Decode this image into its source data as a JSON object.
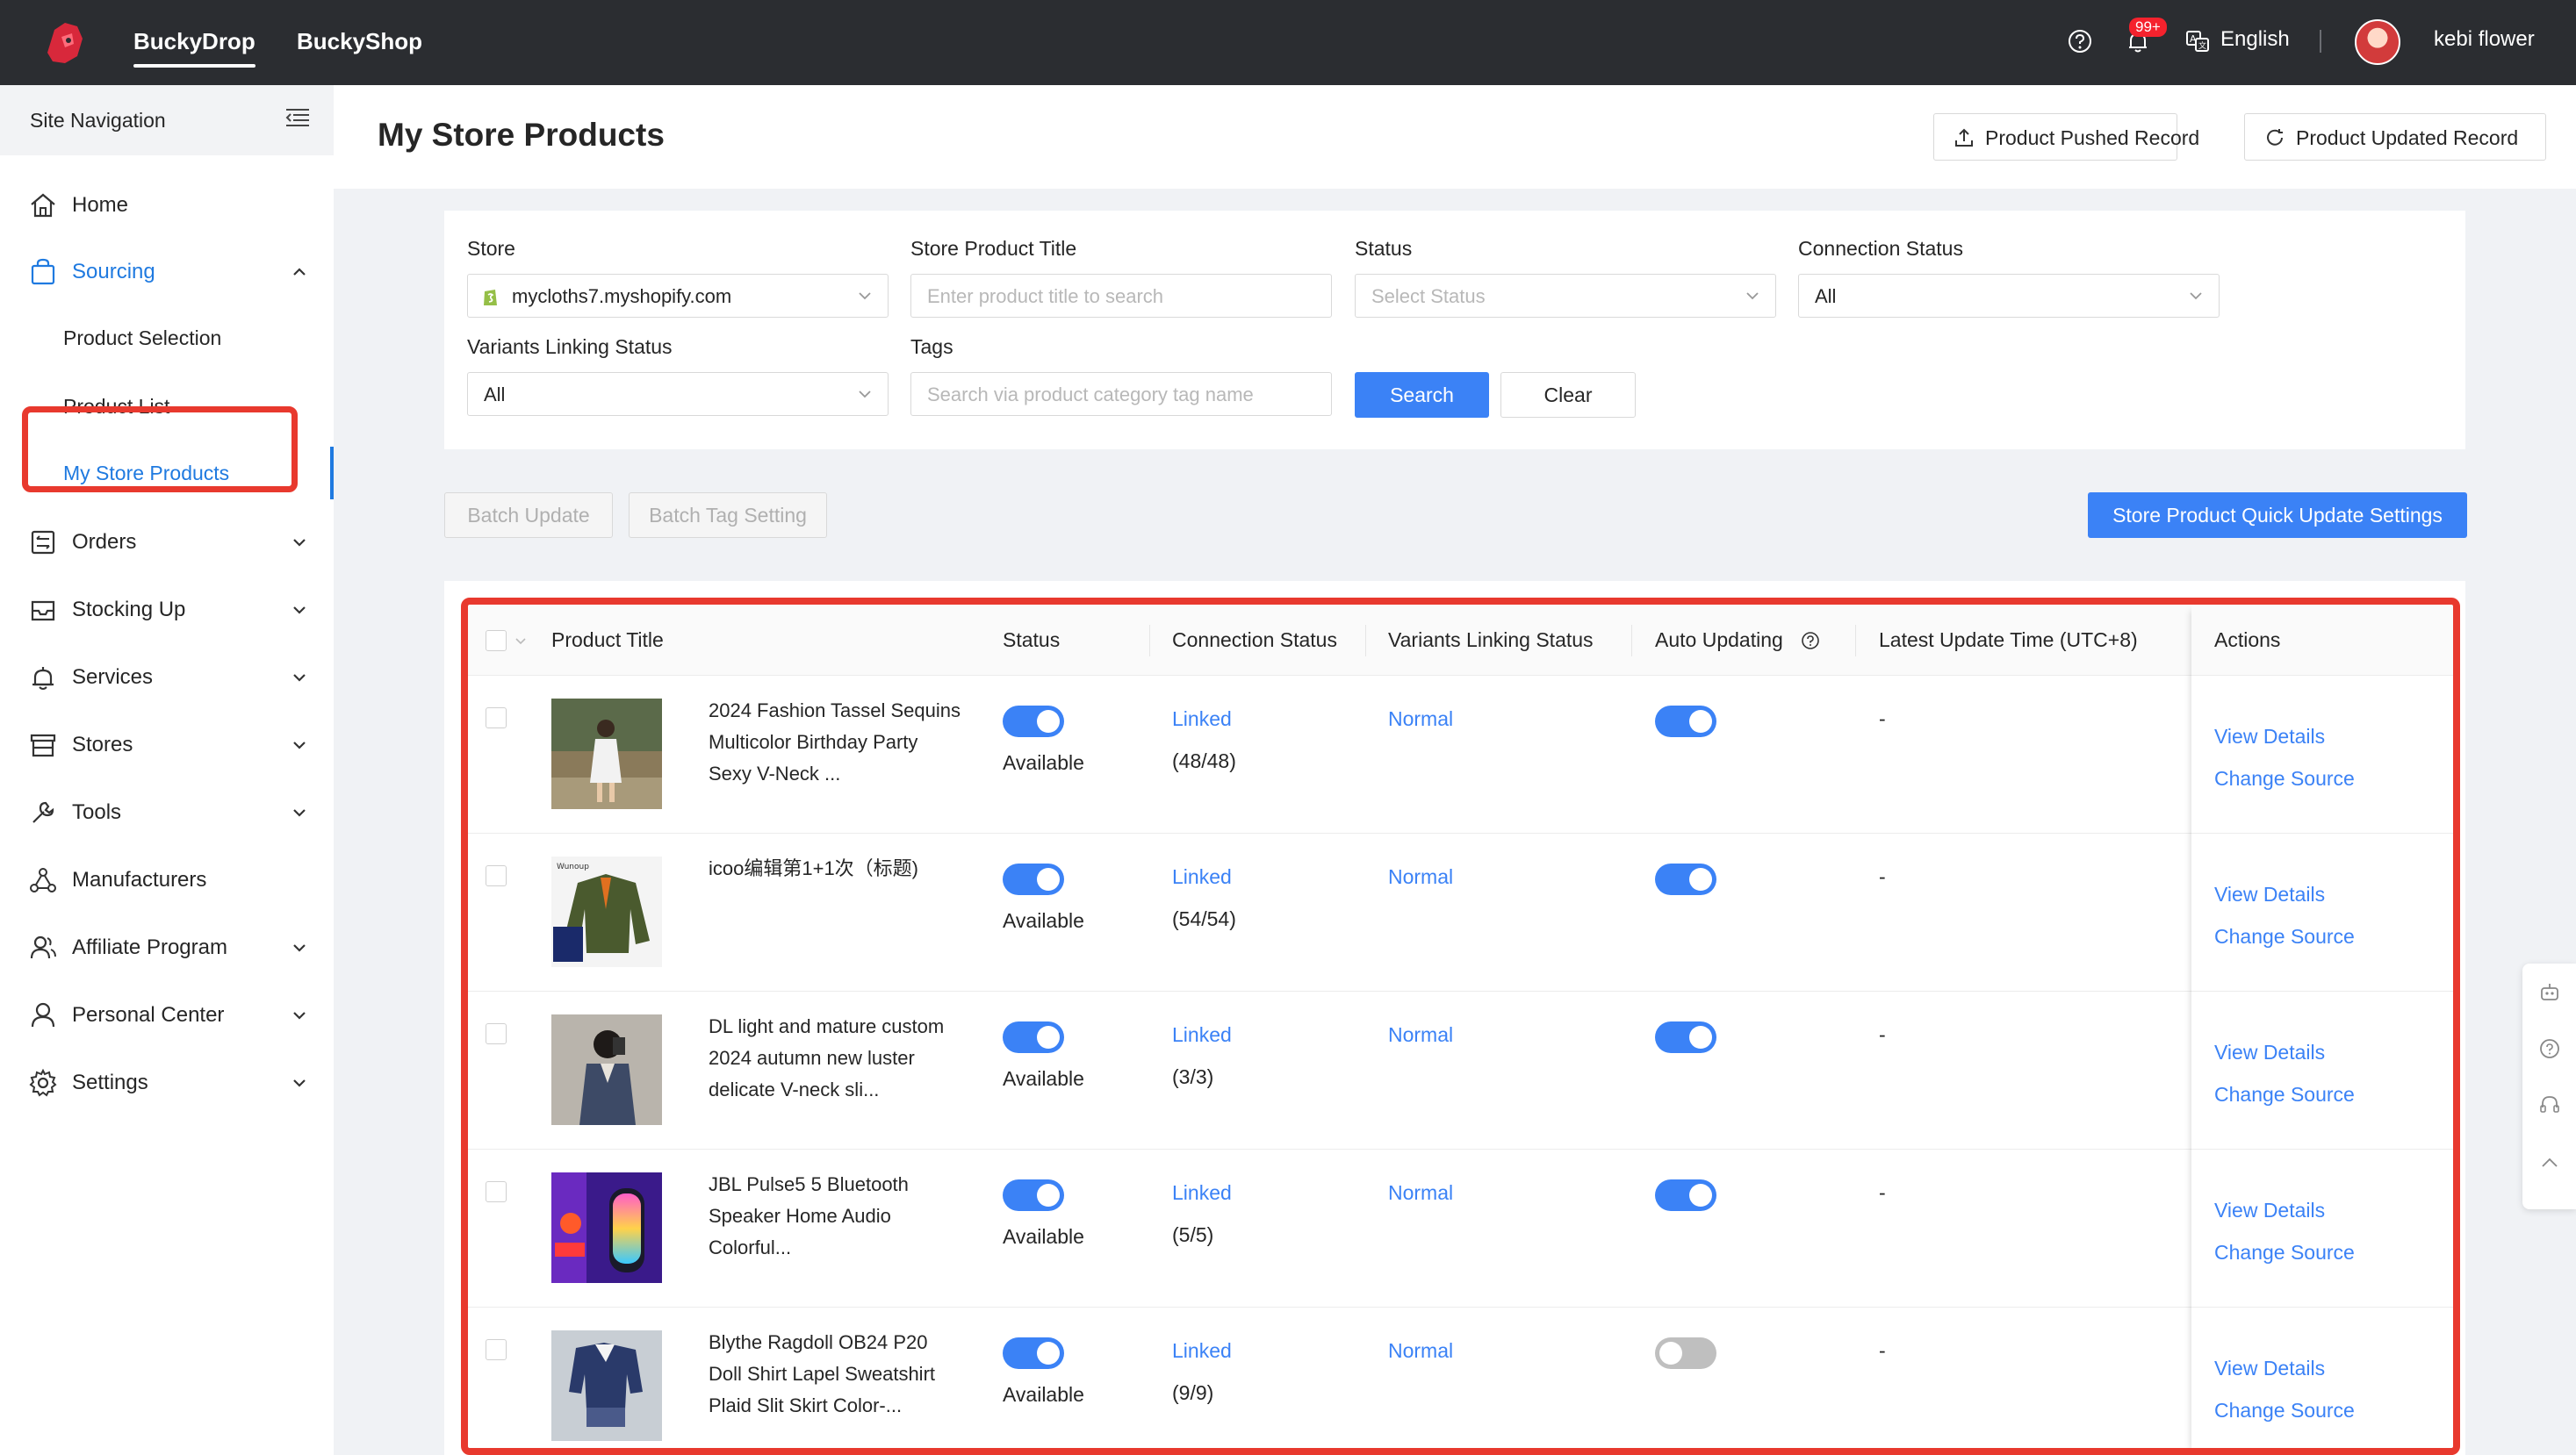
{
  "topbar": {
    "tabs": [
      "BuckyDrop",
      "BuckyShop"
    ],
    "notification_badge": "99+",
    "language": "English",
    "user_name": "kebi flower"
  },
  "sidebar": {
    "header": "Site Navigation",
    "items": {
      "home": "Home",
      "sourcing": "Sourcing",
      "product_selection": "Product Selection",
      "product_list": "Product List",
      "my_store_products": "My Store Products",
      "orders": "Orders",
      "stocking_up": "Stocking Up",
      "services": "Services",
      "stores": "Stores",
      "tools": "Tools",
      "manufacturers": "Manufacturers",
      "affiliate_program": "Affiliate Program",
      "personal_center": "Personal Center",
      "settings": "Settings"
    }
  },
  "header": {
    "title": "My Store Products",
    "pushed_record": "Product Pushed Record",
    "updated_record": "Product Updated Record"
  },
  "filters": {
    "store_label": "Store",
    "store_value": "mycloths7.myshopify.com",
    "title_label": "Store Product Title",
    "title_placeholder": "Enter product title to search",
    "status_label": "Status",
    "status_placeholder": "Select Status",
    "connection_label": "Connection Status",
    "connection_value": "All",
    "variants_label": "Variants Linking Status",
    "variants_value": "All",
    "tags_label": "Tags",
    "tags_placeholder": "Search via product category tag name",
    "search": "Search",
    "clear": "Clear"
  },
  "batch": {
    "update": "Batch Update",
    "tag_setting": "Batch Tag Setting",
    "quick_settings": "Store Product Quick Update Settings"
  },
  "table": {
    "columns": {
      "product_title": "Product Title",
      "status": "Status",
      "connection_status": "Connection Status",
      "variants_linking": "Variants Linking Status",
      "auto_updating": "Auto Updating",
      "latest_update": "Latest Update Time (UTC+8)",
      "actions": "Actions"
    },
    "rows": [
      {
        "title": "2024 Fashion Tassel Sequins Multicolor Birthday Party Sexy V-Neck ...",
        "status": "Available",
        "connection": "Linked",
        "count": "(48/48)",
        "variants": "Normal",
        "auto_on": true,
        "time": "-",
        "view": "View Details",
        "change": "Change Source"
      },
      {
        "title": "icoo编辑第1+1次（标题)",
        "status": "Available",
        "connection": "Linked",
        "count": "(54/54)",
        "variants": "Normal",
        "auto_on": true,
        "time": "-",
        "view": "View Details",
        "change": "Change Source"
      },
      {
        "title": "DL light and mature custom 2024 autumn new luster delicate V-neck sli...",
        "status": "Available",
        "connection": "Linked",
        "count": "(3/3)",
        "variants": "Normal",
        "auto_on": true,
        "time": "-",
        "view": "View Details",
        "change": "Change Source"
      },
      {
        "title": "JBL Pulse5 5 Bluetooth Speaker Home Audio Colorful...",
        "status": "Available",
        "connection": "Linked",
        "count": "(5/5)",
        "variants": "Normal",
        "auto_on": true,
        "time": "-",
        "view": "View Details",
        "change": "Change Source"
      },
      {
        "title": "Blythe Ragdoll OB24 P20 Doll Shirt Lapel Sweatshirt Plaid Slit Skirt Color-...",
        "status": "Available",
        "connection": "Linked",
        "count": "(9/9)",
        "variants": "Normal",
        "auto_on": false,
        "time": "-",
        "view": "View Details",
        "change": "Change Source"
      }
    ]
  },
  "colors": {
    "accent": "#3b82f6",
    "highlight": "#e8392e",
    "topbar": "#2b2d31"
  }
}
